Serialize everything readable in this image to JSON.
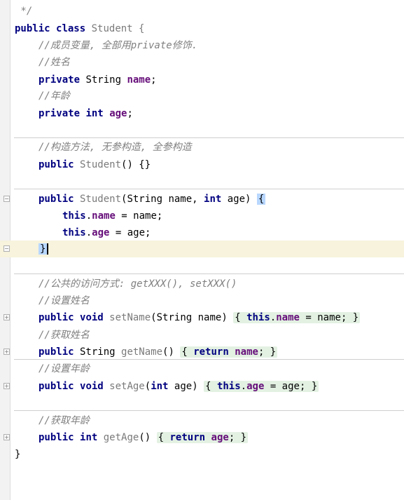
{
  "editor": {
    "l01": {
      "cm": " */"
    },
    "l02": {
      "kw1": "public",
      "kw2": "class",
      "name": " Student {"
    },
    "l03": {
      "cm": "//成员变量, 全部用private修饰."
    },
    "l04": {
      "cm": "//姓名"
    },
    "l05": {
      "kw": "private",
      "type": " String ",
      "fd": "name",
      "end": ";"
    },
    "l06": {
      "cm": "//年龄"
    },
    "l07": {
      "kw1": "private",
      "kw2": "int",
      "fd": "age",
      "end": ";"
    },
    "l08": {
      "cm": "//构造方法, 无参构造, 全参构造"
    },
    "l09": {
      "kw": "public",
      "mt": " Student",
      "rest": "() {}"
    },
    "l10": {
      "kw": "public",
      "mt": " Student",
      "p1": "(String name, ",
      "kw2": "int",
      "p2": " age) ",
      "brace": "{"
    },
    "l11": {
      "kw": "this",
      "dot": ".",
      "fd": "name",
      "rest": " = name;"
    },
    "l12": {
      "kw": "this",
      "dot": ".",
      "fd": "age",
      "rest": " = age;"
    },
    "l13": {
      "brace": "}"
    },
    "l14": {
      "cm": "//公共的访问方式: getXXX(), setXXX()"
    },
    "l15": {
      "cm": "//设置姓名"
    },
    "l16": {
      "kw1": "public",
      "kw2": "void",
      "mt": " setName",
      "p": "(String name) ",
      "b1": "{",
      "kw3": "this",
      "dot": ".",
      "fd": "name",
      "rest": " = name; ",
      "b2": "}"
    },
    "l17": {
      "cm": "//获取姓名"
    },
    "l18": {
      "kw1": "public",
      "type": " String ",
      "mt": "getName",
      "p": "() ",
      "b1": "{",
      "kw2": "return",
      "fd": "name",
      "semi": "; ",
      "b2": "}"
    },
    "l19": {
      "cm": "//设置年龄"
    },
    "l20": {
      "kw1": "public",
      "kw2": "void",
      "mt": " setAge",
      "p1": "(",
      "kw3": "int",
      "p2": " age) ",
      "b1": "{",
      "kw4": "this",
      "dot": ".",
      "fd": "age",
      "rest": " = age; ",
      "b2": "}"
    },
    "l21": {
      "cm": "//获取年龄"
    },
    "l22": {
      "kw1": "public",
      "kw2": "int",
      "mt": " getAge",
      "p": "() ",
      "b1": "{",
      "kw3": "return",
      "fd": "age",
      "semi": "; ",
      "b2": "}"
    },
    "l23": {
      "brace": "}"
    }
  },
  "colors": {
    "keyword": "#000080",
    "comment": "#808080",
    "field": "#660e7a",
    "method": "#7a7a7a",
    "current_line": "#f7f3dc",
    "fold_region": "#e3f1e3",
    "brace_match": "#b8d7ff"
  },
  "icons": [
    "fold-marker-icon",
    "text-caret"
  ]
}
